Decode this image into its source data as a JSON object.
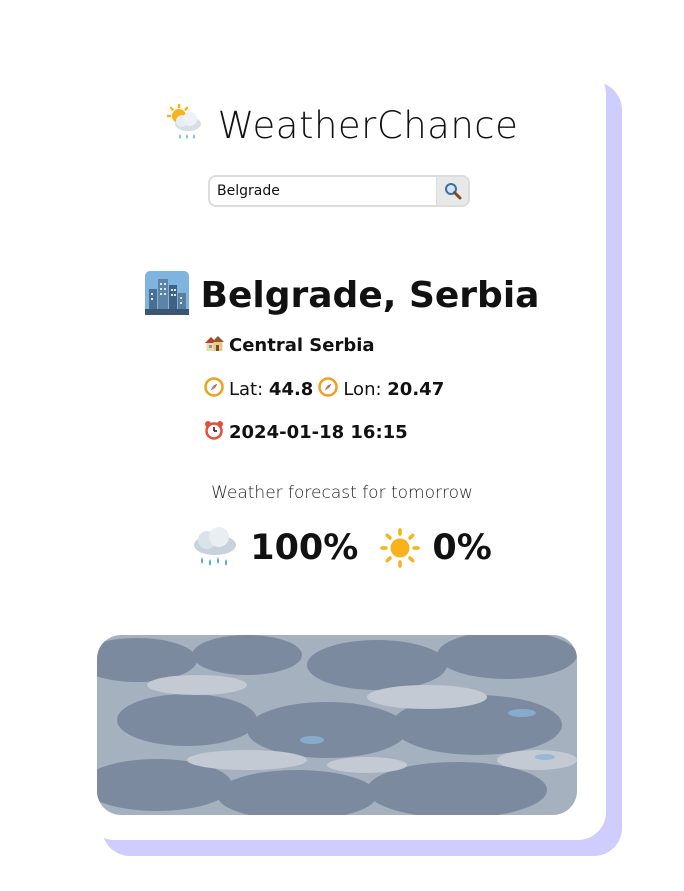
{
  "app": {
    "title": "WeatherChance",
    "logo_icon": "sun-behind-rain-cloud-icon"
  },
  "search": {
    "value": "Belgrade",
    "button_icon": "magnifier-icon"
  },
  "location": {
    "city": "Belgrade, Serbia",
    "city_icon": "cityscape-icon",
    "region": "Central Serbia",
    "region_icon": "houses-icon",
    "lat_label": "Lat:",
    "lat_value": "44.8",
    "lon_label": "Lon:",
    "lon_value": "20.47",
    "coord_icon": "compass-icon",
    "datetime": "2024-01-18 16:15",
    "datetime_icon": "alarm-clock-icon"
  },
  "forecast": {
    "label": "Weather forecast for tomorrow",
    "rain_chance": "100%",
    "rain_icon": "rain-cloud-icon",
    "sun_chance": "0%",
    "sun_icon": "sun-icon"
  },
  "colors": {
    "card_shadow": "#cfcdfd",
    "card_background": "#ffffff",
    "text": "#111111"
  },
  "image": {
    "description_icon": "cloudy-sky-image"
  }
}
